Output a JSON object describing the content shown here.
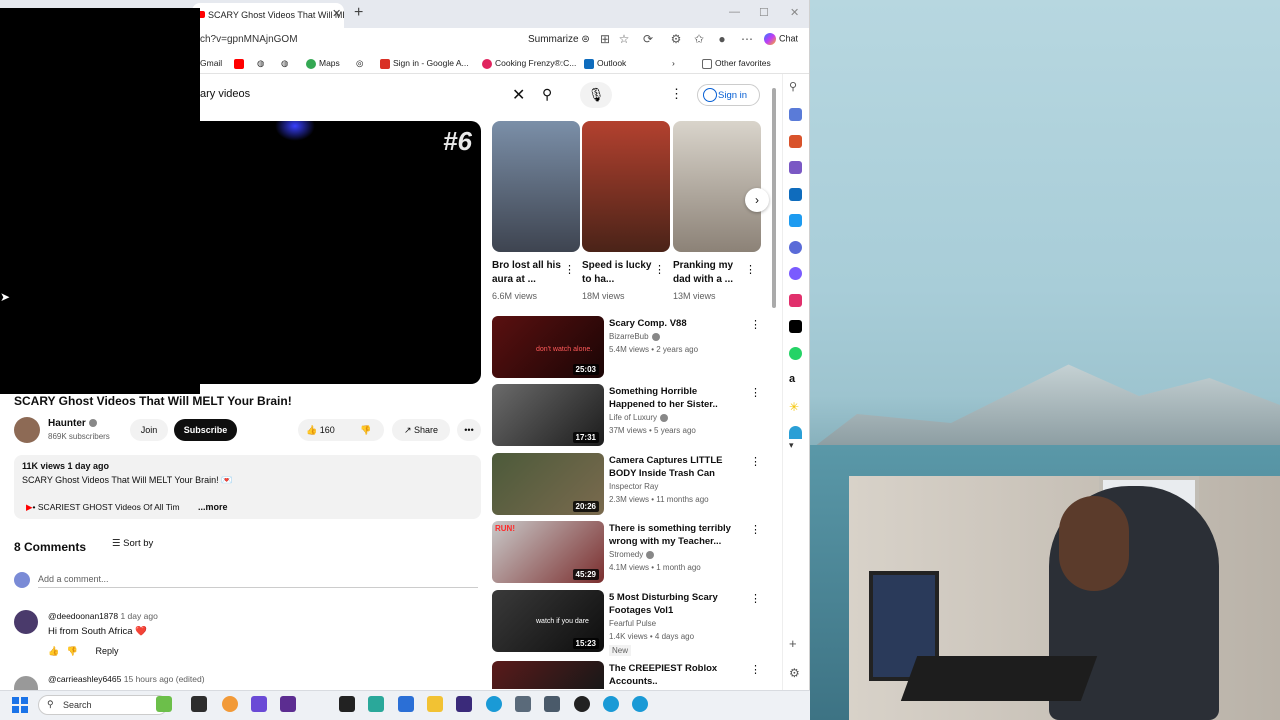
{
  "browser": {
    "tab_title": "SCARY Ghost Videos That Will ME",
    "url": "ch?v=gpnMNAjnGOM",
    "summarize_label": "Summarize",
    "chat_label": "Chat",
    "favorites": [
      {
        "label": "Gmail",
        "icon": "gmail-icon"
      },
      {
        "label": "Maps",
        "icon": "maps-icon"
      },
      {
        "label": "Sign in - Google A...",
        "icon": "gmail-icon"
      },
      {
        "label": "Cooking Frenzy®:C...",
        "icon": "cooking-icon"
      },
      {
        "label": "Outlook",
        "icon": "outlook-icon"
      }
    ],
    "other_favorites": "Other favorites"
  },
  "youtube": {
    "search_query": "ary videos",
    "signin_label": "Sign in",
    "player_overlay": "#6",
    "video": {
      "title": "SCARY Ghost Videos That Will MELT Your Brain!",
      "channel": "Haunter",
      "subscribers": "869K subscribers",
      "join": "Join",
      "subscribe": "Subscribe",
      "likes": "160",
      "share": "Share",
      "views_date": "11K views  1 day ago",
      "desc_line1": "SCARY Ghost Videos That Will MELT Your Brain! 💌",
      "desc_line2": "• SCARIEST GHOST Videos Of All Tim",
      "more": "...more"
    },
    "comments": {
      "count_label": "8 Comments",
      "sort_label": "Sort by",
      "add_placeholder": "Add a comment...",
      "items": [
        {
          "user": "@deedoonan1878",
          "time": "1 day ago",
          "text": "Hi from South Africa ❤️",
          "reply": "Reply"
        },
        {
          "user": "@carrieashley6465",
          "time": "15 hours ago (edited)"
        }
      ]
    },
    "shorts": [
      {
        "title": "Bro lost all his aura at ...",
        "views": "6.6M views"
      },
      {
        "title": "Speed is lucky to ha...",
        "views": "18M views"
      },
      {
        "title": "Pranking my dad with a ...",
        "views": "13M views"
      }
    ],
    "recommendations": [
      {
        "title": "Scary Comp. V88",
        "channel": "BizarreBub",
        "meta": "5.4M views • 2 years ago",
        "duration": "25:03",
        "thumb_text": "don't watch alone."
      },
      {
        "title": "Something Horrible Happened to her Sister..",
        "channel": "Life of Luxury",
        "meta": "37M views • 5 years ago",
        "duration": "17:31"
      },
      {
        "title": "Camera Captures LITTLE BODY Inside Trash Can",
        "channel": "Inspector Ray",
        "meta": "2.3M views • 11 months ago",
        "duration": "20:26"
      },
      {
        "title": "There is something terribly wrong with my Teacher...",
        "channel": "Stromedy",
        "meta": "4.1M views • 1 month ago",
        "duration": "45:29",
        "thumb_text": "RUN!"
      },
      {
        "title": "5 Most Disturbing Scary Footages Vol1",
        "channel": "Fearful Pulse",
        "meta": "1.4K views • 4 days ago",
        "duration": "15:23",
        "thumb_text": "watch if you dare",
        "badge": "New"
      },
      {
        "title": "The CREEPIEST Roblox Accounts..",
        "channel": "",
        "meta": "",
        "duration": ""
      }
    ]
  },
  "taskbar": {
    "search_label": "Search"
  },
  "colors": {
    "youtube_red": "#ff0000",
    "link_blue": "#065fd4"
  }
}
